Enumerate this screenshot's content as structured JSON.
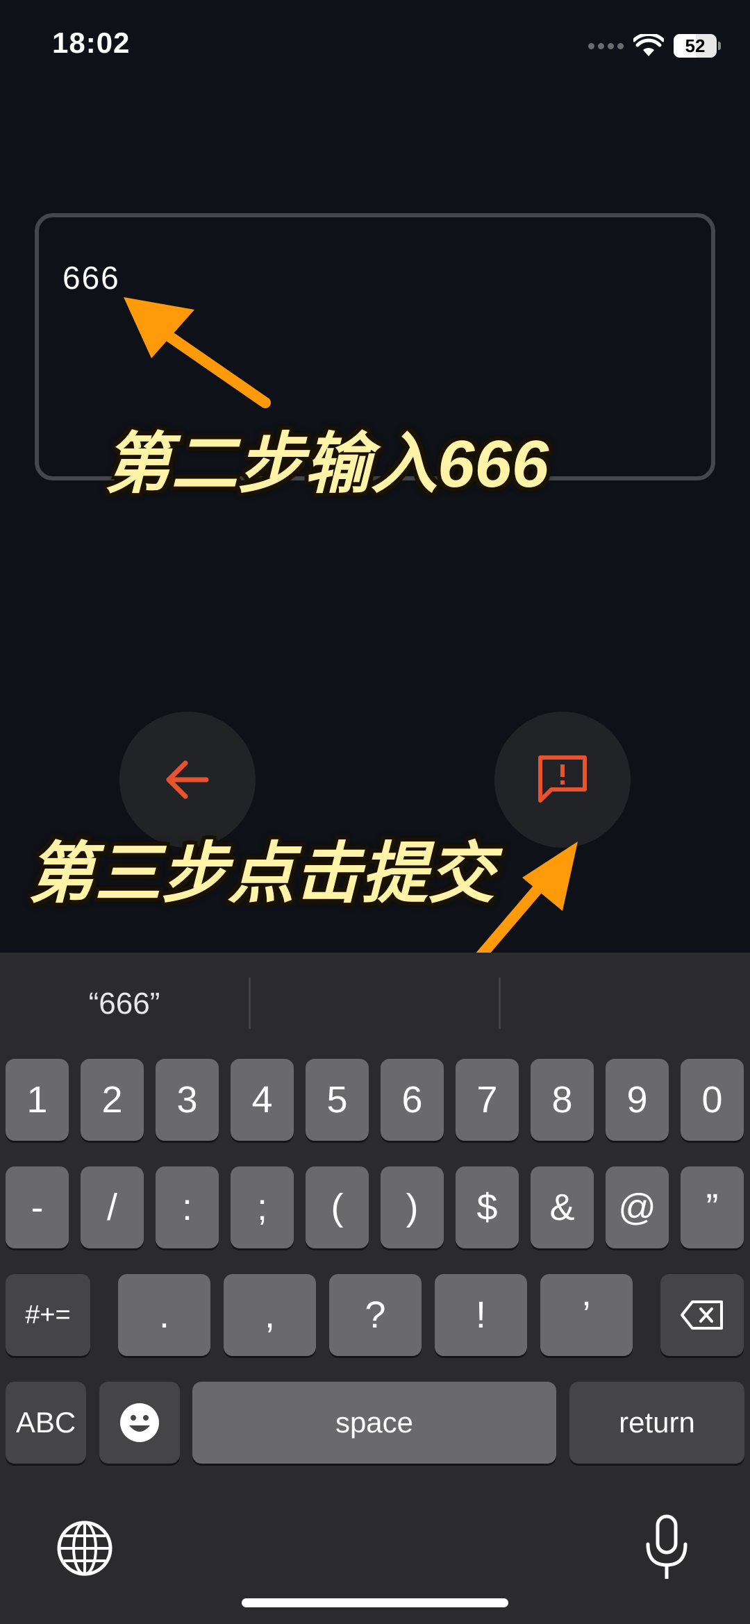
{
  "status_bar": {
    "time": "18:02",
    "battery_level": "52"
  },
  "input": {
    "value": "666"
  },
  "buttons": {
    "back_icon": "arrow-left-icon",
    "submit_icon": "feedback-icon",
    "accent_color": "#e8532f"
  },
  "annotations": {
    "step2": "第二步输入666",
    "step3": "第三步点击提交",
    "arrow_color": "#ff9a0a"
  },
  "keyboard": {
    "suggestions": [
      "“666”",
      "",
      ""
    ],
    "row1": [
      "1",
      "2",
      "3",
      "4",
      "5",
      "6",
      "7",
      "8",
      "9",
      "0"
    ],
    "row2": [
      "-",
      "/",
      ":",
      ";",
      "(",
      ")",
      "$",
      "&",
      "@",
      "”"
    ],
    "row3": {
      "mode_key": "#+=",
      "keys": [
        ".",
        ",",
        "?",
        "!",
        "’"
      ],
      "delete_icon": "backspace-icon"
    },
    "row4": {
      "abc_key": "ABC",
      "emoji_icon": "emoji-icon",
      "space_key": "space",
      "return_key": "return"
    },
    "bottom": {
      "globe_icon": "globe-icon",
      "mic_icon": "microphone-icon"
    }
  }
}
